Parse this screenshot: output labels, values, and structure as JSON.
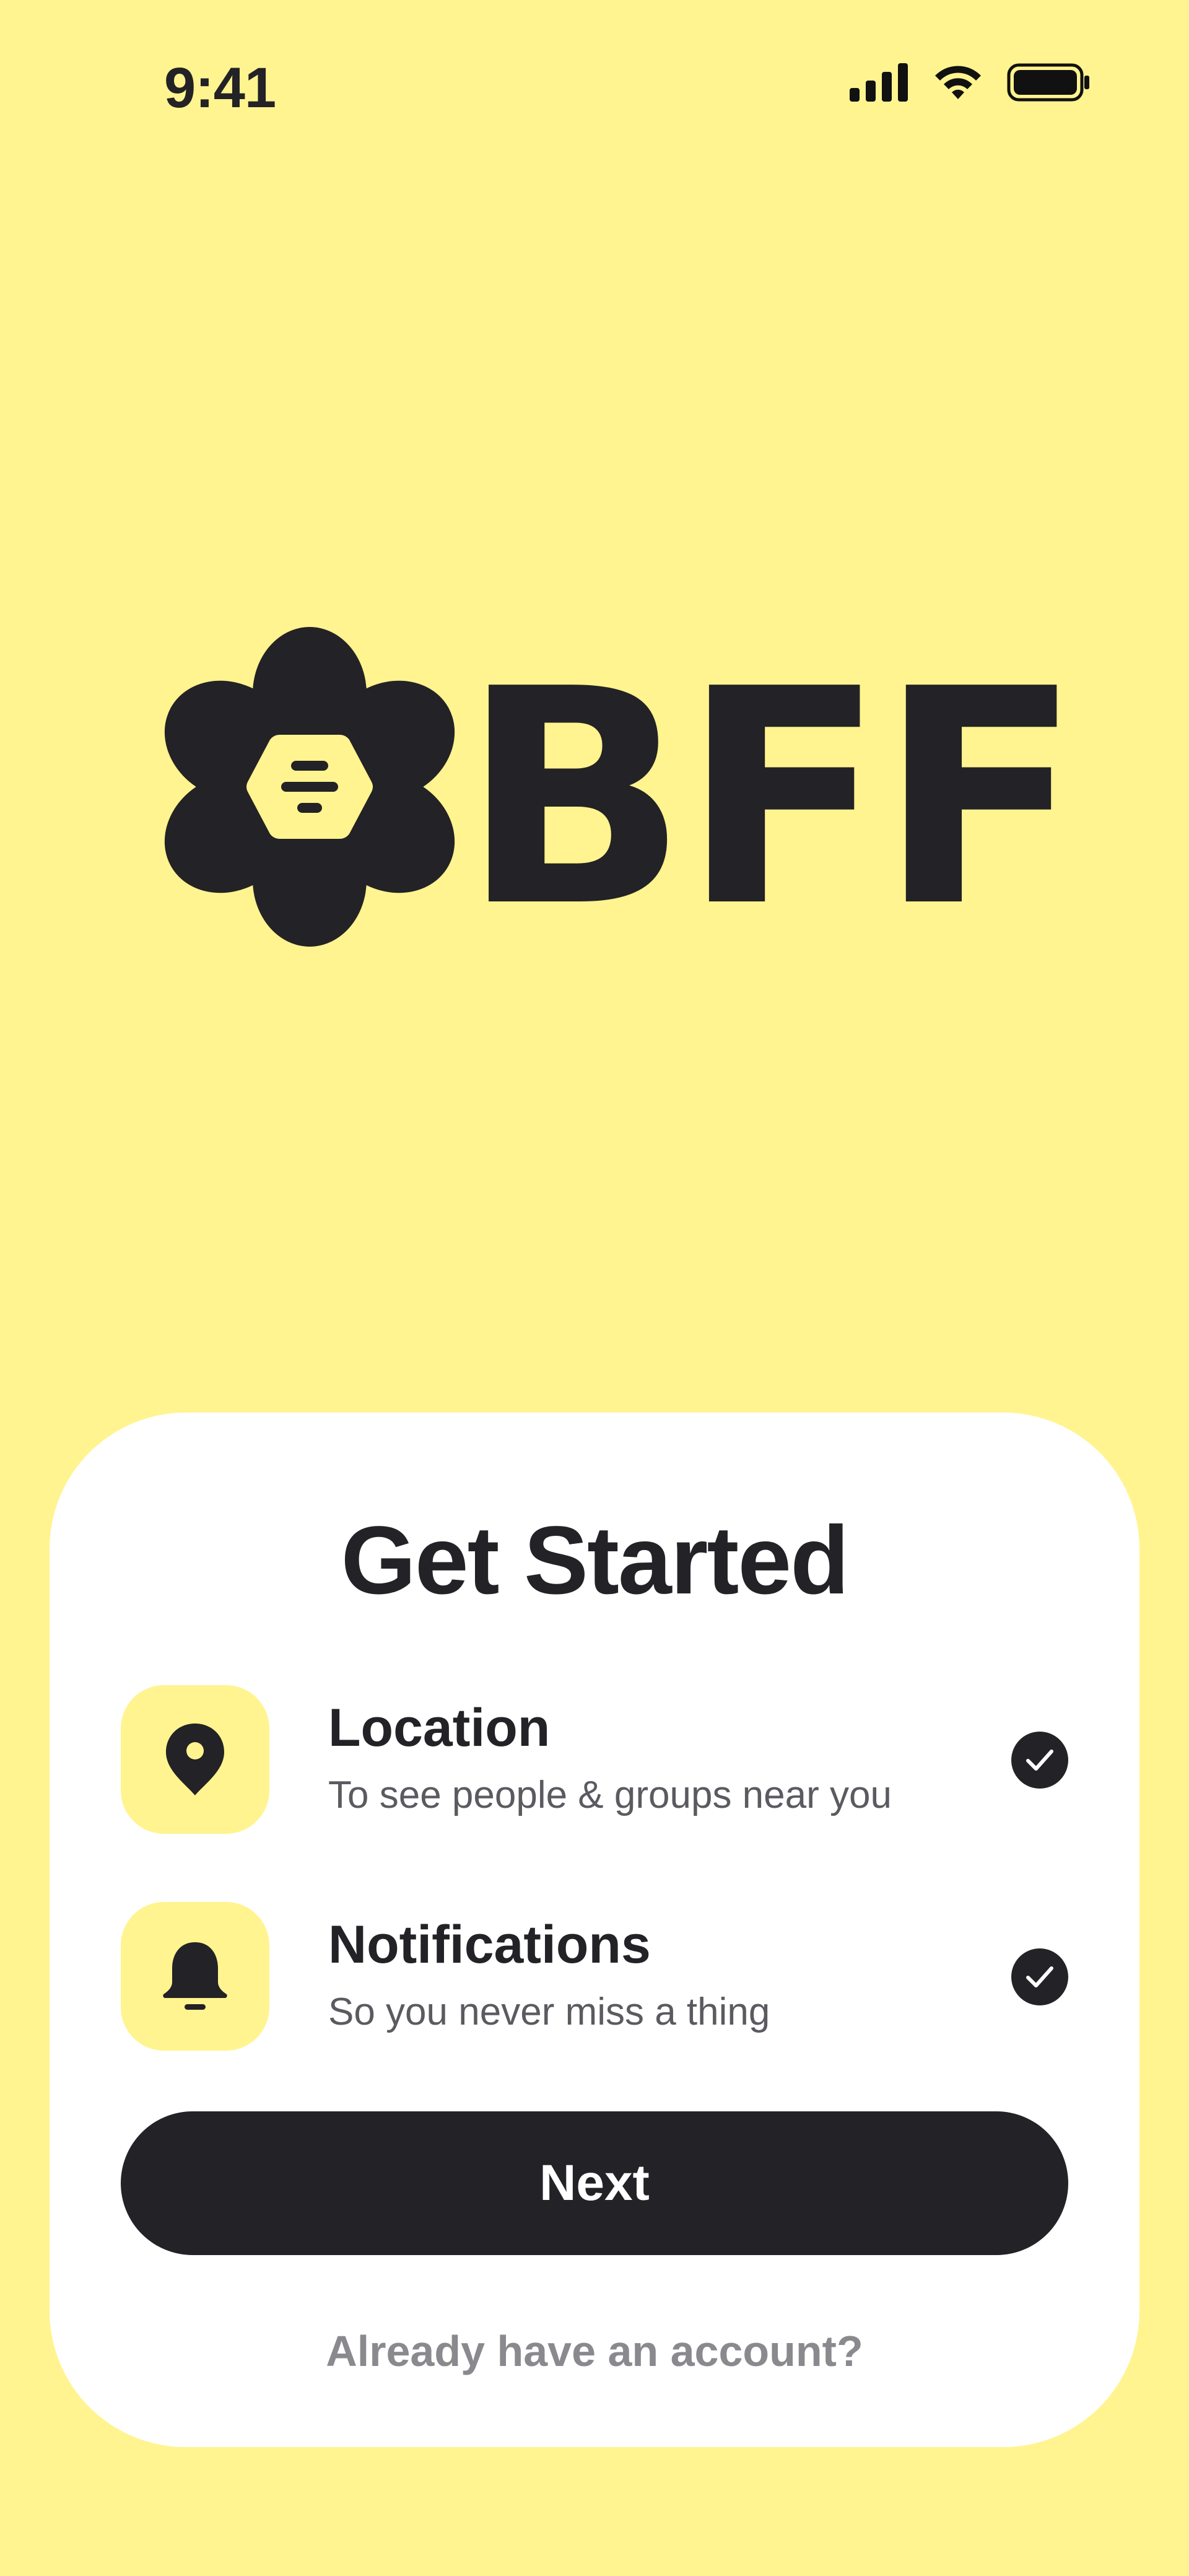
{
  "status_bar": {
    "time": "9:41",
    "icons": [
      "signal-icon",
      "wifi-icon",
      "battery-icon"
    ]
  },
  "logo": {
    "text": "BFF",
    "mark": "flower-hive-icon"
  },
  "card": {
    "title": "Get Started",
    "permissions": [
      {
        "icon": "location-pin-icon",
        "title": "Location",
        "description": "To see people & groups near you",
        "checked": true
      },
      {
        "icon": "bell-icon",
        "title": "Notifications",
        "description": "So you never miss a thing",
        "checked": true
      }
    ],
    "next_label": "Next",
    "account_link": "Already have an account?"
  },
  "colors": {
    "background": "#FFF48F",
    "card": "#FFFFFF",
    "primary": "#232226",
    "muted": "#8A898E"
  }
}
